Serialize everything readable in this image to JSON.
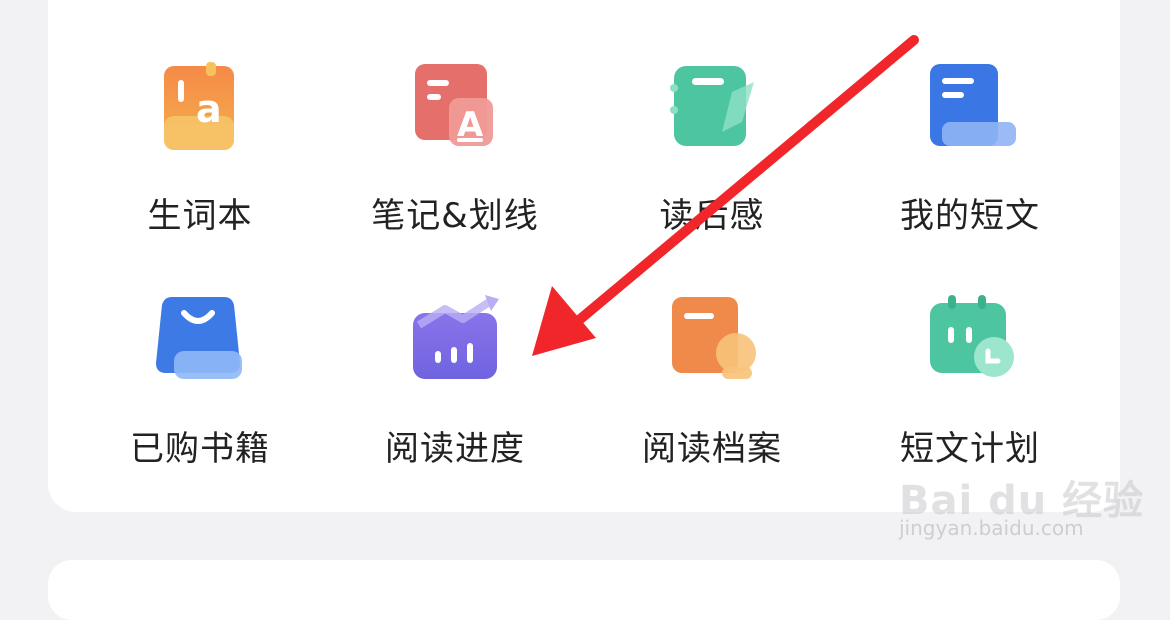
{
  "grid": {
    "items": [
      {
        "label": "生词本",
        "icon": "vocabulary-book-icon"
      },
      {
        "label": "笔记&划线",
        "icon": "notes-highlight-icon"
      },
      {
        "label": "读后感",
        "icon": "book-review-icon"
      },
      {
        "label": "我的短文",
        "icon": "my-essays-icon"
      },
      {
        "label": "已购书籍",
        "icon": "purchased-books-icon"
      },
      {
        "label": "阅读进度",
        "icon": "reading-progress-icon"
      },
      {
        "label": "阅读档案",
        "icon": "reading-profile-icon"
      },
      {
        "label": "短文计划",
        "icon": "essay-plan-icon"
      }
    ]
  },
  "annotation": {
    "type": "red-arrow",
    "color": "#f0262b",
    "points_to": "阅读进度"
  },
  "watermark": {
    "logo": "Bai du 经验",
    "url": "jingyan.baidu.com"
  },
  "colors": {
    "orange": "#f08a4b",
    "red": "#e8736e",
    "green": "#4fc9a3",
    "blue": "#3d7ae6",
    "purple": "#7c6ae6"
  }
}
